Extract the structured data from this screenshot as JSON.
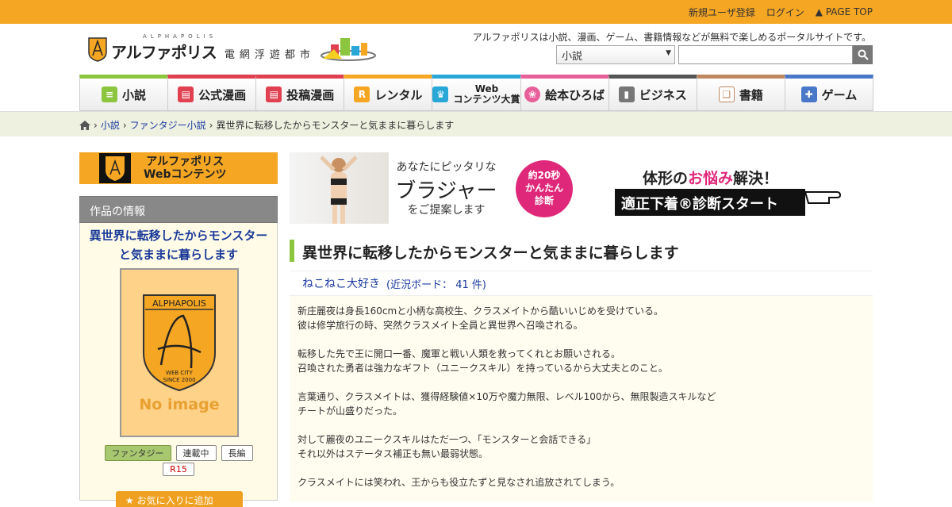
{
  "topbar": {
    "register": "新規ユーザ登録",
    "login": "ログイン",
    "pagetop": "PAGE TOP"
  },
  "header": {
    "logo_en": "ALPHAPOLIS",
    "logo_jp": "アルファポリス",
    "logo_sub": "電網浮遊都市",
    "tagline": "アルファポリスは小説、漫画、ゲーム、書籍情報などが無料で楽しめるポータルサイトです。",
    "search_category": "小説",
    "search_value": ""
  },
  "nav": [
    {
      "label": "小説",
      "color": "#8cc63f"
    },
    {
      "label": "公式漫画",
      "color": "#e04050"
    },
    {
      "label": "投稿漫画",
      "color": "#e04050"
    },
    {
      "label": "レンタル",
      "color": "#f5a623"
    },
    {
      "label_l1": "Web",
      "label_l2": "コンテンツ大賞",
      "color": "#29a8d8"
    },
    {
      "label": "絵本ひろば",
      "color": "#e8609a"
    },
    {
      "label": "ビジネス",
      "color": "#555555"
    },
    {
      "label": "書籍",
      "color": "#c08860"
    },
    {
      "label": "ゲーム",
      "color": "#4a78c8"
    }
  ],
  "breadcrumb": {
    "item1": "小説",
    "item2": "ファンタジー小説",
    "current": "異世界に転移したからモンスターと気ままに暮らします"
  },
  "sidebar": {
    "banner_l1": "アルファポリス",
    "banner_l2": "Webコンテンツ",
    "info_heading": "作品の情報",
    "work_title": "異世界に転移したからモンスターと気ままに暮らします",
    "cover_logo": "ALPHAPOLIS",
    "cover_tagline_1": "WEB CITY",
    "cover_tagline_2": "SINCE 2000",
    "no_image": "No image",
    "tags": [
      "ファンタジー",
      "連載中",
      "長編"
    ],
    "rating": "R15",
    "fav_button": "お気に入りに追加"
  },
  "ad": {
    "copy1": "あなたにピッタリな",
    "copy2": "ブラジャー",
    "copy3": "をご提案します",
    "badge_l1": "約20秒",
    "badge_l2": "かんたん",
    "badge_l3": "診断",
    "worry_pre": "体形の",
    "worry_pink": "お悩み",
    "worry_post": "解決！",
    "cta": "適正下着®診断スタート"
  },
  "work": {
    "title": "異世界に転移したからモンスターと気ままに暮らします",
    "author": "ねこねこ大好き",
    "board": "(近況ボード： 41 件)",
    "synopsis": [
      "新庄麗夜は身長160cmと小柄な高校生、クラスメイトから酷いいじめを受けている。",
      "彼は修学旅行の時、突然クラスメイト全員と異世界へ召喚される。",
      "",
      "転移した先で王に開口一番、魔軍と戦い人類を救ってくれとお願いされる。",
      "召喚された勇者は強力なギフト（ユニークスキル）を持っているから大丈夫とのこと。",
      "",
      "言葉通り、クラスメイトは、獲得経験値×10万や魔力無限、レベル100から、無限製造スキルなど",
      "チートが山盛りだった。",
      "",
      "対して麗夜のユニークスキルはただ一つ、「モンスターと会話できる」",
      "それ以外はステータス補正も無い最弱状態。",
      "",
      "クラスメイトには笑われ、王からも役立たずと見なされ追放されてしまう。"
    ]
  },
  "colors": {
    "accent": "#f5a623",
    "link": "#1a3aa0",
    "title_bar": "#8cc63f"
  }
}
